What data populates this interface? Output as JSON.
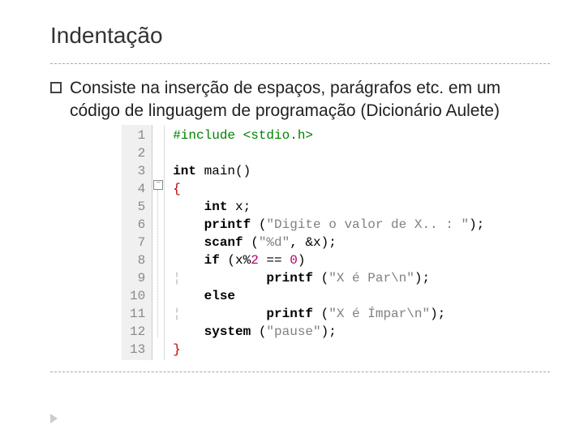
{
  "title": "Indentação",
  "bullet": {
    "text": "Consiste na inserção de espaços, parágrafos etc. em um código de linguagem de programação (Dicionário Aulete)"
  },
  "code": {
    "lines": [
      "1",
      "2",
      "3",
      "4",
      "5",
      "6",
      "7",
      "8",
      "9",
      "10",
      "11",
      "12",
      "13"
    ],
    "fold_symbol": "−",
    "src": {
      "l1_pp": "#include <stdio.h>",
      "l3_kw": "int",
      "l3_rest": " main()",
      "l4_brace_open": "{",
      "l5_kw": "    int",
      "l5_rest": " x;",
      "l6_func": "    printf",
      "l6_open": " (",
      "l6_str": "\"Digite o valor de X.. : \"",
      "l6_close": ");",
      "l7_func": "    scanf",
      "l7_open": " (",
      "l7_str": "\"%d\"",
      "l7_close": ", &x);",
      "l8_kw": "    if",
      "l8_open": " (x%",
      "l8_num": "2",
      "l8_rest": " == ",
      "l8_num2": "0",
      "l8_close": ")",
      "l9_func": "        printf",
      "l9_open": " (",
      "l9_str": "\"X é Par\\n\"",
      "l9_close": ");",
      "l10_kw": "    else",
      "l11_func": "        printf",
      "l11_open": " (",
      "l11_str": "\"X é Ímpar\\n\"",
      "l11_close": ");",
      "l12_func": "    system",
      "l12_open": " (",
      "l12_str": "\"pause\"",
      "l12_close": ");",
      "l13_brace_close": "}"
    }
  }
}
